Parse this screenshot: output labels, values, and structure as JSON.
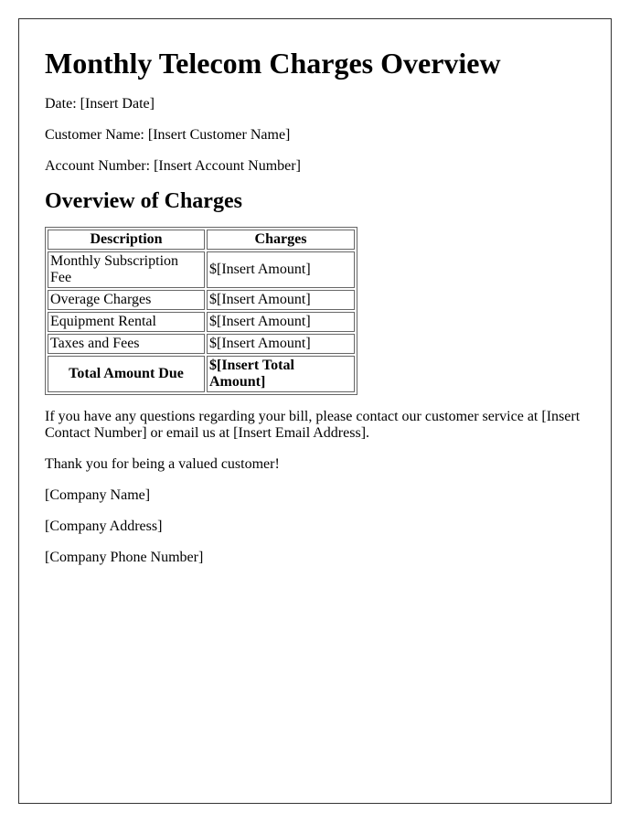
{
  "document": {
    "title": "Monthly Telecom Charges Overview",
    "fields": [
      {
        "label": "Date:",
        "value": "[Insert Date]"
      },
      {
        "label": "Customer Name:",
        "value": "[Insert Customer Name]"
      },
      {
        "label": "Account Number:",
        "value": "[Insert Account Number]"
      }
    ],
    "section_heading": "Overview of Charges",
    "table": {
      "headers": [
        "Description",
        "Charges"
      ],
      "rows": [
        {
          "description": "Monthly Subscription Fee",
          "charge": "$[Insert Amount]"
        },
        {
          "description": "Overage Charges",
          "charge": "$[Insert Amount]"
        },
        {
          "description": "Equipment Rental",
          "charge": "$[Insert Amount]"
        },
        {
          "description": "Taxes and Fees",
          "charge": "$[Insert Amount]"
        }
      ],
      "total": {
        "label": "Total Amount Due",
        "value": "$[Insert Total Amount]"
      }
    },
    "contact_paragraph": "If you have any questions regarding your bill, please contact our customer service at [Insert Contact Number] or email us at [Insert Email Address].",
    "thanks": "Thank you for being a valued customer!",
    "signature": {
      "company_name": "[Company Name]",
      "company_address": "[Company Address]",
      "company_phone": "[Company Phone Number]"
    }
  }
}
